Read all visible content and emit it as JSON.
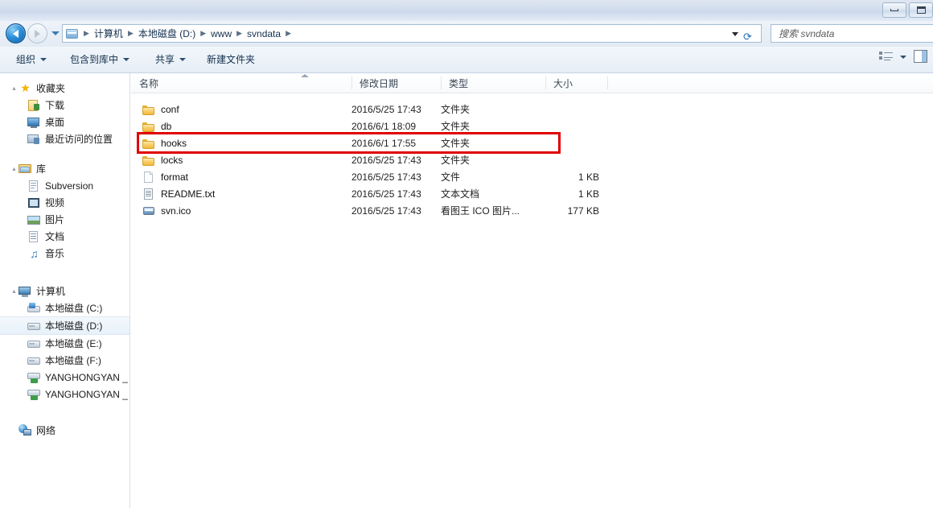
{
  "window": {
    "buttons": [
      {
        "name": "minimize",
        "icon": "minimize-icon"
      },
      {
        "name": "maximize",
        "icon": "maximize-icon"
      }
    ]
  },
  "navigation": {
    "back_icon": "back-arrow-icon",
    "forward_icon": "forward-arrow-icon",
    "history_icon": "history-dropdown-icon",
    "refresh_icon": "refresh-icon",
    "breadcrumb_icon": "folder-icon",
    "breadcrumb": [
      "计算机",
      "本地磁盘 (D:)",
      "www",
      "svndata"
    ],
    "separator": "▶"
  },
  "search": {
    "placeholder": "搜索 svndata",
    "icon": "search-icon"
  },
  "toolbar": {
    "items": [
      {
        "label": "组织",
        "caret": true
      },
      {
        "label": "包含到库中",
        "caret": true
      },
      {
        "label": "共享",
        "caret": true
      },
      {
        "label": "新建文件夹",
        "caret": false
      }
    ],
    "view_icon": "view-layout-icon",
    "view_caret_icon": "chevron-down-icon",
    "preview_icon": "preview-pane-icon"
  },
  "sidebar": {
    "groups": [
      {
        "name": "favorites",
        "header": {
          "label": "收藏夹",
          "icon": "star-icon",
          "expander": "▴"
        },
        "items": [
          {
            "label": "下载",
            "icon": "downloads-icon"
          },
          {
            "label": "桌面",
            "icon": "desktop-icon"
          },
          {
            "label": "最近访问的位置",
            "icon": "recent-places-icon"
          }
        ]
      },
      {
        "name": "libraries",
        "header": {
          "label": "库",
          "icon": "library-icon",
          "expander": "▴"
        },
        "items": [
          {
            "label": "Subversion",
            "icon": "subversion-library-icon"
          },
          {
            "label": "视频",
            "icon": "videos-icon"
          },
          {
            "label": "图片",
            "icon": "pictures-icon"
          },
          {
            "label": "文档",
            "icon": "documents-icon"
          },
          {
            "label": "音乐",
            "icon": "music-icon"
          }
        ]
      },
      {
        "name": "computer",
        "header": {
          "label": "计算机",
          "icon": "computer-icon",
          "expander": "▴"
        },
        "items": [
          {
            "label": "本地磁盘 (C:)",
            "icon": "system-drive-icon",
            "selected": false
          },
          {
            "label": "本地磁盘 (D:)",
            "icon": "drive-icon",
            "selected": true
          },
          {
            "label": "本地磁盘 (E:)",
            "icon": "drive-icon",
            "selected": false
          },
          {
            "label": "本地磁盘 (F:)",
            "icon": "drive-icon",
            "selected": false
          },
          {
            "label": "YANGHONGYAN _",
            "icon": "network-drive-icon",
            "selected": false
          },
          {
            "label": "YANGHONGYAN _",
            "icon": "network-drive-icon",
            "selected": false
          }
        ]
      },
      {
        "name": "network",
        "header": {
          "label": "网络",
          "icon": "network-icon",
          "expander": ""
        },
        "items": []
      }
    ]
  },
  "filelist": {
    "columns": [
      {
        "key": "name",
        "label": "名称",
        "sorted": "asc"
      },
      {
        "key": "date",
        "label": "修改日期"
      },
      {
        "key": "type",
        "label": "类型"
      },
      {
        "key": "size",
        "label": "大小"
      }
    ],
    "rows": [
      {
        "name": "conf",
        "date": "2016/5/25 17:43",
        "type": "文件夹",
        "size": "",
        "icon": "folder-icon",
        "highlighted": false
      },
      {
        "name": "db",
        "date": "2016/6/1 18:09",
        "type": "文件夹",
        "size": "",
        "icon": "folder-icon",
        "highlighted": false
      },
      {
        "name": "hooks",
        "date": "2016/6/1 17:55",
        "type": "文件夹",
        "size": "",
        "icon": "folder-icon",
        "highlighted": true
      },
      {
        "name": "locks",
        "date": "2016/5/25 17:43",
        "type": "文件夹",
        "size": "",
        "icon": "folder-icon",
        "highlighted": false
      },
      {
        "name": "format",
        "date": "2016/5/25 17:43",
        "type": "文件",
        "size": "1 KB",
        "icon": "file-icon",
        "highlighted": false
      },
      {
        "name": "README.txt",
        "date": "2016/5/25 17:43",
        "type": "文本文档",
        "size": "1 KB",
        "icon": "text-file-icon",
        "highlighted": false
      },
      {
        "name": "svn.ico",
        "date": "2016/5/25 17:43",
        "type": "看图王 ICO 图片...",
        "size": "177 KB",
        "icon": "ico-file-icon",
        "highlighted": false
      }
    ]
  },
  "annotation": {
    "color": "#e00000",
    "target_row": "hooks"
  }
}
